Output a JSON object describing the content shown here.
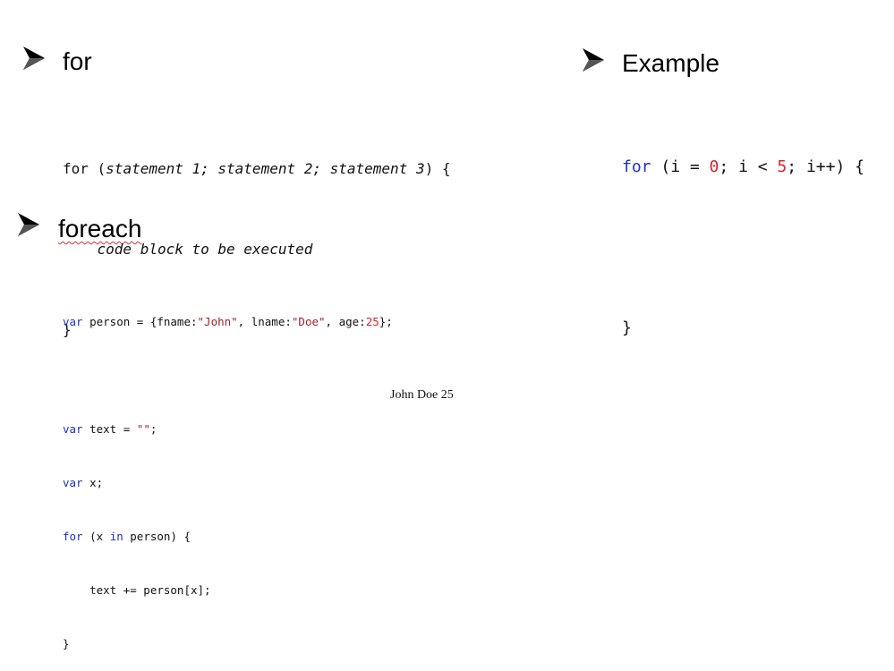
{
  "left_top": {
    "heading": "for",
    "syntax_lines": [
      {
        "prefix": "for (",
        "italic": "statement 1; statement 2; statement 3",
        "suffix": ") {"
      },
      {
        "prefix": "    ",
        "italic": "code block to be executed",
        "suffix": ""
      },
      {
        "prefix": "}",
        "italic": "",
        "suffix": ""
      }
    ]
  },
  "right_top": {
    "heading": "Example",
    "example": {
      "kw_for": "for",
      "part_open": " (i = ",
      "num_start": "0",
      "part_mid": "; i < ",
      "num_end": "5",
      "part_close": "; i++) {",
      "closing_brace": "}"
    }
  },
  "left_bottom": {
    "heading": "foreach",
    "code": {
      "line1": {
        "kw": "var",
        "a": " person = {fname:",
        "s1": "\"John\"",
        "b": ", lname:",
        "s2": "\"Doe\"",
        "c": ", age:",
        "n": "25",
        "d": "};"
      },
      "line2": {
        "kw": "var",
        "a": " text = ",
        "s": "\"\"",
        "b": ";"
      },
      "line3": {
        "kw": "var",
        "a": " x;"
      },
      "line4": {
        "kw": "for",
        "a": " (x ",
        "kw2": "in",
        "b": " person) {"
      },
      "line5": {
        "a": "    text += person[x];"
      },
      "line6": {
        "a": "}"
      }
    },
    "output": "John Doe 25"
  },
  "colors": {
    "keyword": "#1c2fc7",
    "number": "#d3242b",
    "string": "#a3212a",
    "spellcheck_underline": "#d8322a"
  },
  "icons": [
    "arrow-bullet-icon",
    "arrow-bullet-icon",
    "arrow-bullet-icon"
  ]
}
